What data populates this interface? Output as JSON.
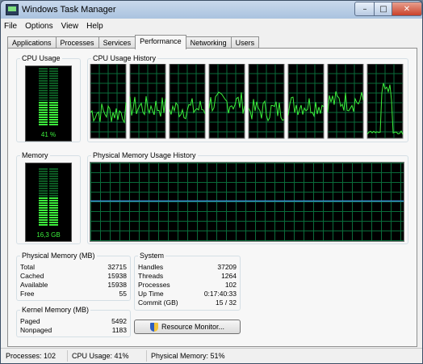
{
  "window": {
    "title": "Windows Task Manager",
    "min_glyph": "–",
    "max_glyph": "□",
    "close_glyph": "✕"
  },
  "menu": [
    "File",
    "Options",
    "View",
    "Help"
  ],
  "tabs": [
    "Applications",
    "Processes",
    "Services",
    "Performance",
    "Networking",
    "Users"
  ],
  "active_tab": "Performance",
  "cpu": {
    "label": "CPU Usage",
    "percent_text": "41 %",
    "level": 0.41
  },
  "cpu_history": {
    "label": "CPU Usage History",
    "core_count": 8
  },
  "memory": {
    "label": "Memory",
    "value_text": "16,3 GB",
    "level": 0.51
  },
  "mem_history": {
    "label": "Physical Memory Usage History",
    "level": 0.51
  },
  "physical_memory": {
    "label": "Physical Memory (MB)",
    "rows": [
      {
        "k": "Total",
        "v": "32715"
      },
      {
        "k": "Cached",
        "v": "15938"
      },
      {
        "k": "Available",
        "v": "15938"
      },
      {
        "k": "Free",
        "v": "55"
      }
    ]
  },
  "kernel_memory": {
    "label": "Kernel Memory (MB)",
    "rows": [
      {
        "k": "Paged",
        "v": "5492"
      },
      {
        "k": "Nonpaged",
        "v": "1183"
      }
    ]
  },
  "system": {
    "label": "System",
    "rows": [
      {
        "k": "Handles",
        "v": "37209"
      },
      {
        "k": "Threads",
        "v": "1264"
      },
      {
        "k": "Processes",
        "v": "102"
      },
      {
        "k": "Up Time",
        "v": "0:17:40:33"
      },
      {
        "k": "Commit (GB)",
        "v": "15 / 32"
      }
    ]
  },
  "resource_button": "Resource Monitor...",
  "status": {
    "processes": "Processes: 102",
    "cpu": "CPU Usage: 41%",
    "memory": "Physical Memory: 51%"
  },
  "colors": {
    "graph_green": "#3cf03c",
    "mem_line": "#3b8fd6",
    "grid": "#0a6b3a"
  }
}
